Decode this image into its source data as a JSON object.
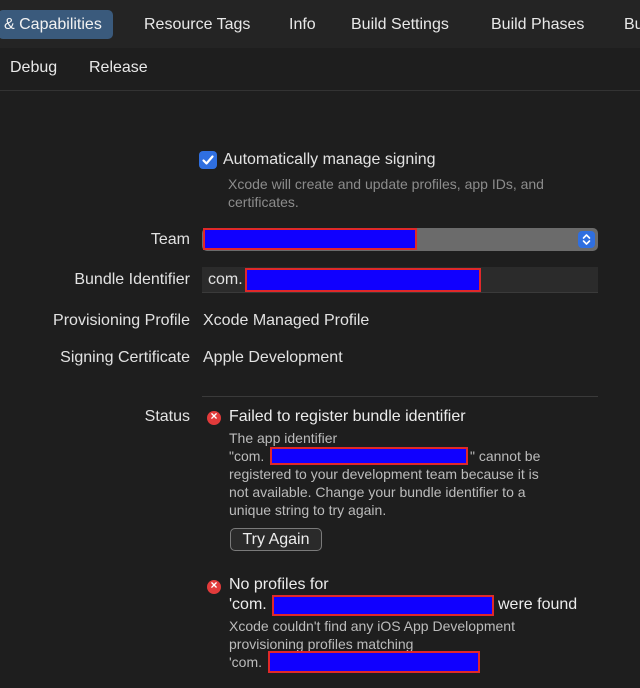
{
  "tabs": [
    {
      "label": "& Capabilities",
      "selected": true
    },
    {
      "label": "Resource Tags"
    },
    {
      "label": "Info"
    },
    {
      "label": "Build Settings"
    },
    {
      "label": "Build Phases"
    },
    {
      "label": "Bu"
    }
  ],
  "subtabs": [
    "Debug",
    "Release"
  ],
  "signing": {
    "auto_manage_label": "Automatically manage signing",
    "auto_manage_checked": true,
    "auto_manage_hint_line1": "Xcode will create and update profiles, app IDs, and",
    "auto_manage_hint_line2": "certificates.",
    "team_label": "Team",
    "bundle_label": "Bundle Identifier",
    "bundle_prefix": "com.",
    "profile_label": "Provisioning Profile",
    "profile_value": "Xcode Managed Profile",
    "certificate_label": "Signing Certificate",
    "certificate_value": "Apple Development",
    "status_label": "Status"
  },
  "errors": {
    "first": {
      "title": "Failed to register bundle identifier",
      "line1": "The app identifier",
      "line2_prefix": "\"com.",
      "line2_suffix": "\" cannot be",
      "line3": "registered to your development team because it is",
      "line4": "not available. Change your bundle identifier to a",
      "line5": "unique string to try again.",
      "button": "Try Again"
    },
    "second": {
      "title_line1": "No profiles for",
      "title_line2_prefix": "'com.",
      "title_line2_suffix": "were found",
      "body_line1": "Xcode couldn't find any iOS App Development",
      "body_line2": "provisioning profiles matching",
      "body_line3_prefix": "'com."
    }
  },
  "colors": {
    "accent": "#2f6fe0",
    "error": "#e23b3b",
    "redaction_fill": "#1000ff",
    "redaction_border": "#e0282a"
  },
  "icons": {
    "checkbox": "checkmark-icon",
    "popup": "chevron-up-down-icon",
    "error": "error-x-icon"
  }
}
